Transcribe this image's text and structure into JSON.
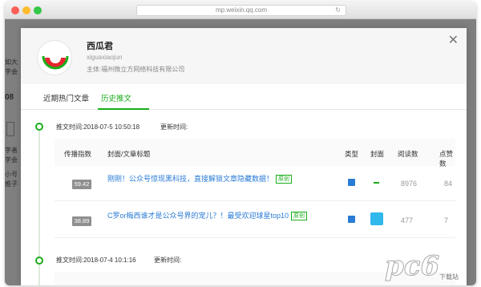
{
  "browser": {
    "url": "mp.weixin.qq.com"
  },
  "background": {
    "fragments": [
      "如大",
      "字会",
      "08",
      "字者",
      "字会",
      "小号",
      "推子"
    ]
  },
  "account": {
    "name": "西瓜君",
    "id": "xiguaxiaojun",
    "entity": "主体:福州微立方网络科技有限公司"
  },
  "tabs": [
    {
      "label": "近期热门文章",
      "active": false
    },
    {
      "label": "历史推文",
      "active": true
    }
  ],
  "table_headers": [
    "传播指数",
    "封面/文章标题",
    "类型",
    "封面",
    "阅读数",
    "点赞数"
  ],
  "groups": [
    {
      "push_time": "推文时间:2018-07-5 10:50:18",
      "update_label": "更新时间:",
      "rows": [
        {
          "spread_index": "59.42",
          "title": "刚刚！公众号惊现黑科技，直接解锁文章隐藏数据！",
          "badge": "原创",
          "reads": "8976",
          "likes": "84"
        },
        {
          "spread_index": "38.89",
          "title": "C罗or梅西谁才是公众号界的宠儿？！最受欢迎球星top10",
          "badge": "原创",
          "reads": "477",
          "likes": "7"
        }
      ]
    },
    {
      "push_time": "推文时间:2018-07-4 10:1:16",
      "update_label": "更新时间:"
    }
  ],
  "watermark": {
    "brand": "pc6",
    "sub": "下载站"
  },
  "colors": {
    "accent": "#1aad19",
    "link": "#2a7bd5",
    "badge_bg": "#8f8f8f"
  }
}
